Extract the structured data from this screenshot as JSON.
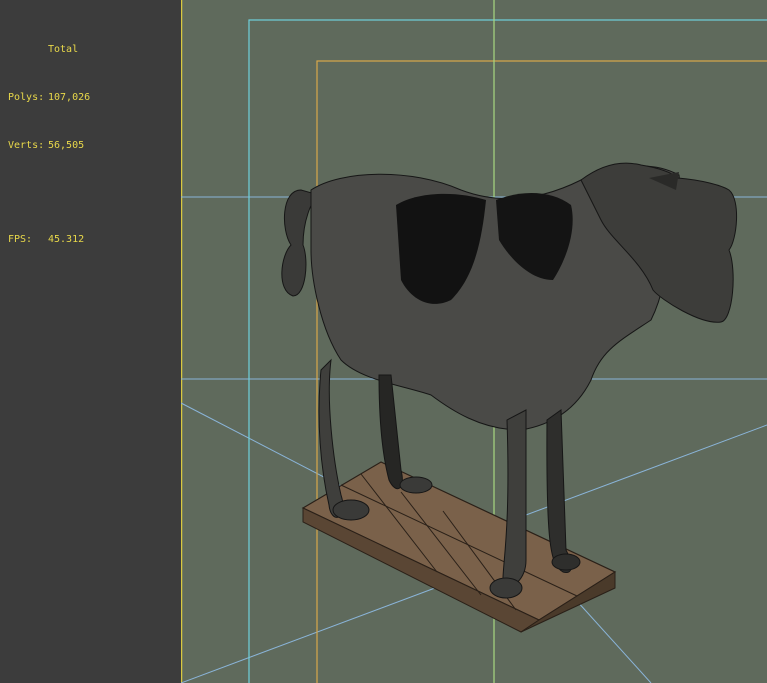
{
  "stats": {
    "title": "Total",
    "polys_label": "Polys:",
    "polys_value": "107,026",
    "verts_label": "Verts:",
    "verts_value": "56,505",
    "fps_label": "FPS:",
    "fps_value": "45.312"
  },
  "colors": {
    "viewport_bg": "#5f6a5c",
    "panel_bg": "#3c3c3c",
    "stats_text": "#e8d84a",
    "safe_frame_cyan": "#6fd0dc",
    "safe_frame_orange": "#d8a84a",
    "viewport_border_yellow": "#d8c840",
    "center_line_green": "#a8d880",
    "perspective_lines": "#8ab4d8"
  }
}
